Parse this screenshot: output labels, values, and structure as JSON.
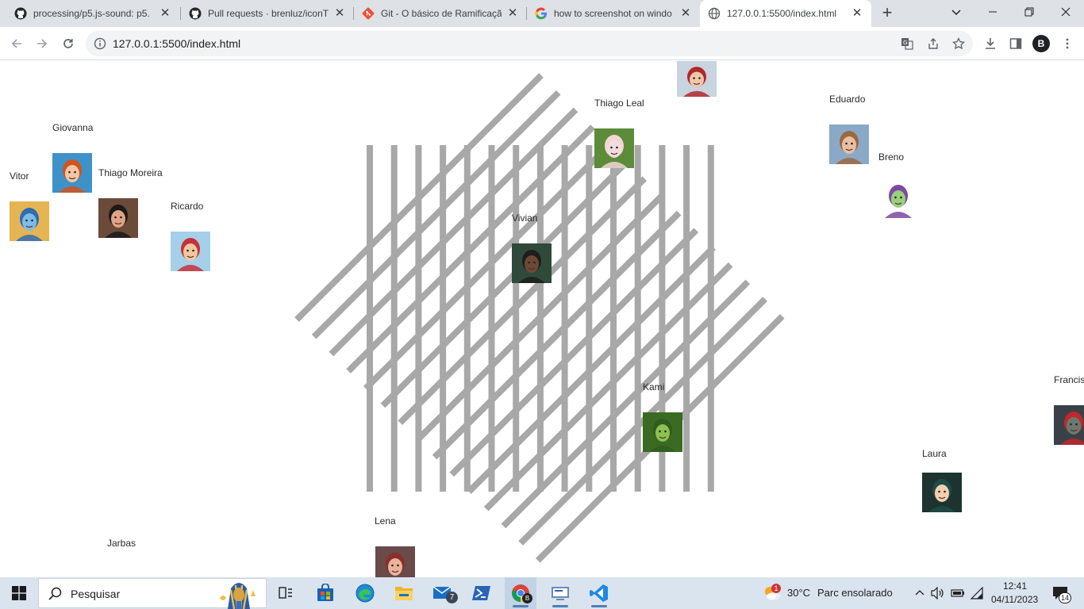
{
  "browser": {
    "tabs": [
      {
        "title": "processing/p5.js-sound: p5.",
        "icon": "github-icon",
        "active": false
      },
      {
        "title": "Pull requests · brenluz/iconT",
        "icon": "github-icon",
        "active": false
      },
      {
        "title": "Git - O básico de Ramificaçã",
        "icon": "git-icon",
        "active": false
      },
      {
        "title": "how to screenshot on windo",
        "icon": "google-icon",
        "active": false
      },
      {
        "title": "127.0.0.1:5500/index.html",
        "icon": "globe-icon",
        "active": true
      }
    ],
    "url": "127.0.0.1:5500/index.html",
    "profile_initial": "B"
  },
  "page": {
    "people": [
      {
        "name": "Giovanna",
        "hair": "#d2541c",
        "bg": "#3f92c8",
        "skin": "#f3c7a6"
      },
      {
        "name": "Vitor",
        "hair": "#2e6db0",
        "bg": "#e6b453",
        "skin": "#7fbbe6"
      },
      {
        "name": "Thiago Moreira",
        "hair": "#1a1a1a",
        "bg": "#6c4a3a",
        "skin": "#e0a383"
      },
      {
        "name": "Ricardo",
        "hair": "#c4313a",
        "bg": "#a6cfe9",
        "skin": "#f0c8a0"
      },
      {
        "name": "Thiago Leal",
        "hair": "#f2d6d6",
        "bg": "#5c8c3a",
        "skin": "#f5dcdc"
      },
      {
        "name": "Vivian",
        "hair": "#1d1d1d",
        "bg": "#2f4a3b",
        "skin": "#6b4a35"
      },
      {
        "name": "Eduardo",
        "hair": "#9a6a3e",
        "bg": "#8aa9c8",
        "skin": "#e8bfa0"
      },
      {
        "name": "Breno",
        "hair": "#7d4aa0",
        "bg": "#ffffff",
        "skin": "#9bd07a"
      },
      {
        "name": "Kami",
        "hair": "#2f5d1f",
        "bg": "#3b6b22",
        "skin": "#8fc050"
      },
      {
        "name": "Francis",
        "hair": "#c0282b",
        "bg": "#3a4048",
        "skin": "#6a7a70"
      },
      {
        "name": "Laura",
        "hair": "#1f4b45",
        "bg": "#1c3330",
        "skin": "#f4cfae"
      },
      {
        "name": "Lena",
        "hair": "#8a2e2e",
        "bg": "#6b4a4a",
        "skin": "#e8b49a"
      },
      {
        "name": "Jarbas",
        "hair": "",
        "bg": "",
        "skin": ""
      },
      {
        "name": "",
        "hair": "#b0282b",
        "bg": "#c8d4e0",
        "skin": "#f0c8a8"
      }
    ],
    "line_color": "#a8a8a8"
  },
  "taskbar": {
    "search_placeholder": "Pesquisar",
    "mail_badge": "7",
    "weather_alert": "1",
    "weather_temp": "30°C",
    "weather_text": "Parc ensolarado",
    "time": "12:41",
    "date": "04/11/2023",
    "notification_count": "14"
  }
}
